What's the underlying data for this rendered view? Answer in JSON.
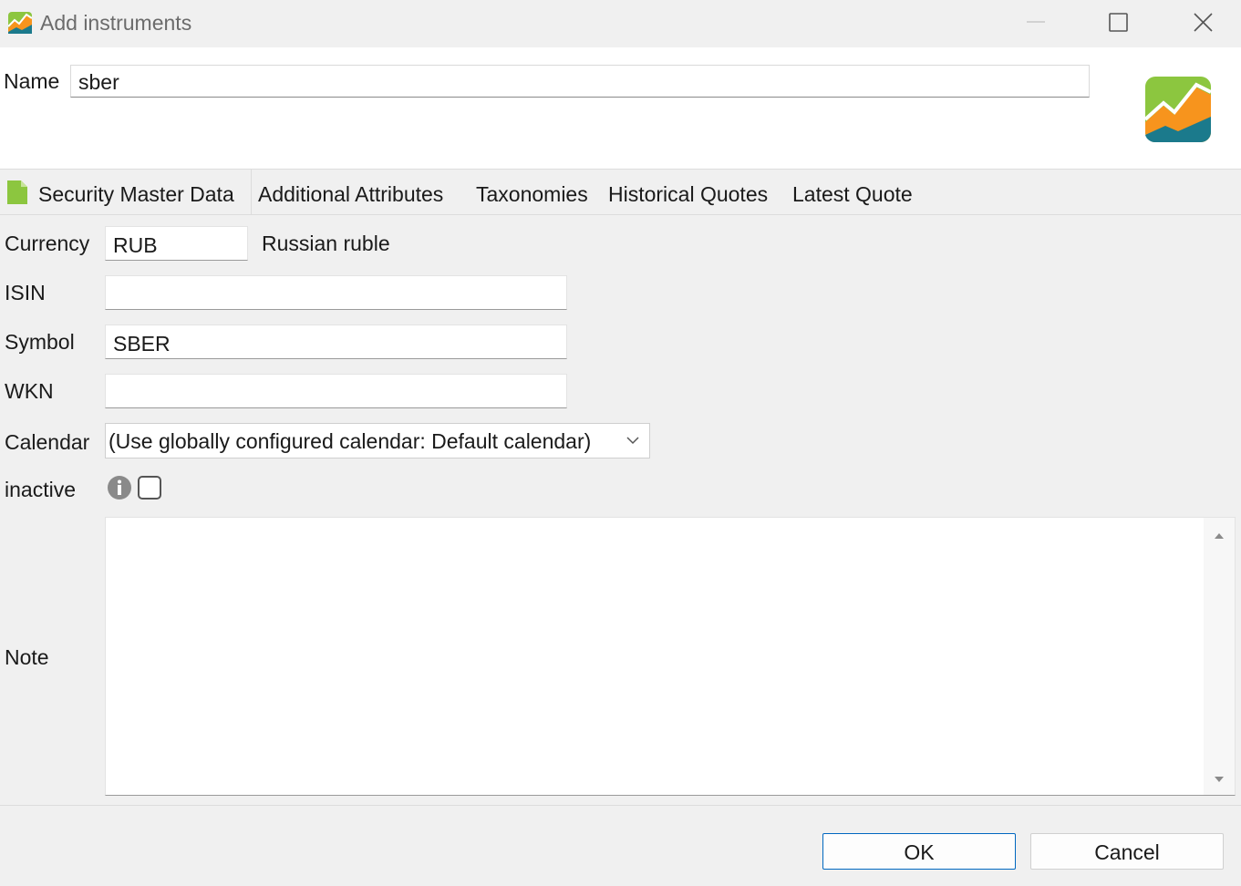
{
  "window": {
    "title": "Add instruments",
    "controls": {
      "minimize": "minimize-icon",
      "maximize": "maximize-icon",
      "close": "close-icon"
    }
  },
  "header": {
    "name_label": "Name",
    "name_value": "sber"
  },
  "tabs": [
    {
      "label": "Security Master Data",
      "active": true,
      "icon": "document-icon"
    },
    {
      "label": "Additional Attributes"
    },
    {
      "label": "Taxonomies"
    },
    {
      "label": "Historical Quotes"
    },
    {
      "label": "Latest Quote"
    }
  ],
  "form": {
    "currency": {
      "label": "Currency",
      "value": "RUB",
      "description": "Russian ruble"
    },
    "isin": {
      "label": "ISIN",
      "value": ""
    },
    "symbol": {
      "label": "Symbol",
      "value": "SBER"
    },
    "wkn": {
      "label": "WKN",
      "value": ""
    },
    "calendar": {
      "label": "Calendar",
      "value": "(Use globally configured calendar: Default calendar)"
    },
    "inactive": {
      "label": "inactive",
      "checked": false
    },
    "note": {
      "label": "Note",
      "value": ""
    }
  },
  "buttons": {
    "ok": "OK",
    "cancel": "Cancel"
  },
  "colors": {
    "accent": "#0067c0",
    "logo_green": "#8cc63f",
    "logo_orange": "#f7941d",
    "logo_teal": "#1b7a8c"
  }
}
